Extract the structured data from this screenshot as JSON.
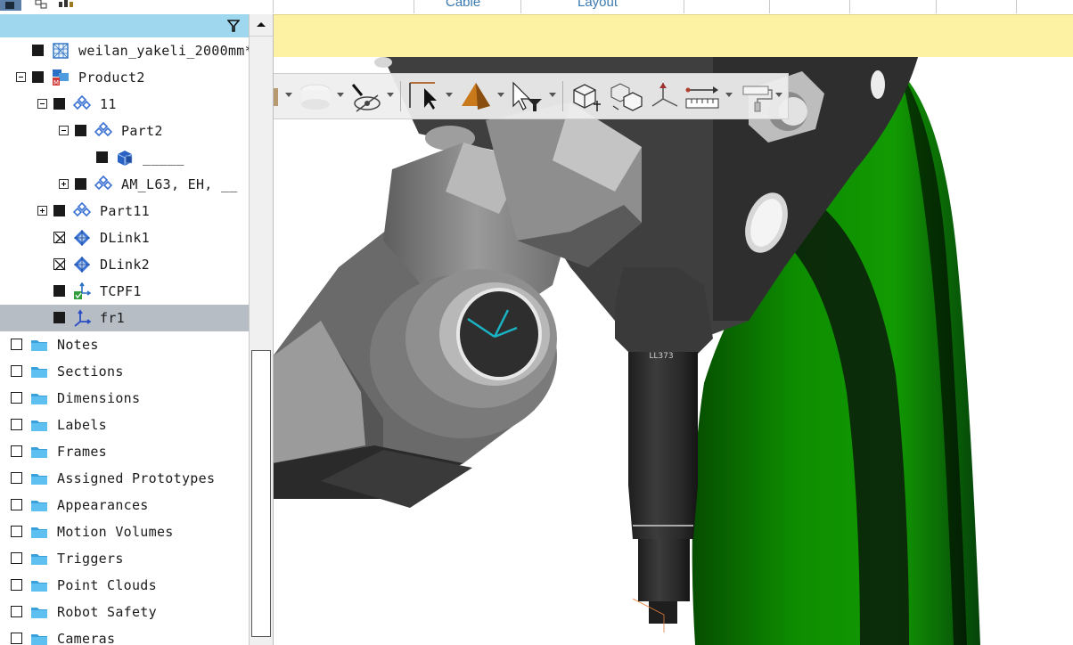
{
  "top_ribbon": {
    "tab_cable": "Cable",
    "tab_layout": "Layout"
  },
  "tree": {
    "filter_icon": "filter-icon",
    "items": [
      {
        "label": "weilan_yakeli_2000mm*",
        "icon": "mesh-part-icon",
        "level": 1,
        "state": "filled",
        "expander": "none"
      },
      {
        "label": "Product2",
        "icon": "product-icon",
        "level": 1,
        "state": "filled",
        "expander": "minus"
      },
      {
        "label": "11",
        "icon": "component-icon",
        "level": 2,
        "state": "filled",
        "expander": "minus"
      },
      {
        "label": "Part2",
        "icon": "component-icon",
        "level": 3,
        "state": "filled",
        "expander": "minus"
      },
      {
        "label": "_____",
        "icon": "part-body-icon",
        "level": 4,
        "state": "filled",
        "expander": "none"
      },
      {
        "label": "AM_L63, EH, __",
        "icon": "component-icon",
        "level": 3,
        "state": "filled",
        "expander": "plus"
      },
      {
        "label": "Part11",
        "icon": "component-icon",
        "level": 2,
        "state": "filled",
        "expander": "plus"
      },
      {
        "label": "DLink1",
        "icon": "link-icon",
        "level": 2,
        "state": "crossed",
        "expander": "none"
      },
      {
        "label": "DLink2",
        "icon": "link-icon",
        "level": 2,
        "state": "crossed",
        "expander": "none"
      },
      {
        "label": "TCPF1",
        "icon": "tcp-frame-icon",
        "level": 2,
        "state": "filled",
        "expander": "none"
      },
      {
        "label": "fr1",
        "icon": "frame-icon",
        "level": 2,
        "state": "filled",
        "expander": "none",
        "selected": true
      },
      {
        "label": "Notes",
        "icon": "folder-icon",
        "level": 0,
        "state": "empty",
        "expander": "none"
      },
      {
        "label": "Sections",
        "icon": "folder-icon",
        "level": 0,
        "state": "empty",
        "expander": "none"
      },
      {
        "label": "Dimensions",
        "icon": "folder-icon",
        "level": 0,
        "state": "empty",
        "expander": "none"
      },
      {
        "label": "Labels",
        "icon": "folder-icon",
        "level": 0,
        "state": "empty",
        "expander": "none"
      },
      {
        "label": "Frames",
        "icon": "folder-icon",
        "level": 0,
        "state": "empty",
        "expander": "none"
      },
      {
        "label": "Assigned Prototypes",
        "icon": "folder-icon",
        "level": 0,
        "state": "empty",
        "expander": "none"
      },
      {
        "label": "Appearances",
        "icon": "folder-icon",
        "level": 0,
        "state": "empty",
        "expander": "none"
      },
      {
        "label": "Motion Volumes",
        "icon": "folder-icon",
        "level": 0,
        "state": "empty",
        "expander": "none"
      },
      {
        "label": "Triggers",
        "icon": "folder-icon",
        "level": 0,
        "state": "empty",
        "expander": "none"
      },
      {
        "label": "Point Clouds",
        "icon": "folder-icon",
        "level": 0,
        "state": "empty",
        "expander": "none"
      },
      {
        "label": "Robot Safety",
        "icon": "folder-icon",
        "level": 0,
        "state": "empty",
        "expander": "none"
      },
      {
        "label": "Cameras",
        "icon": "folder-icon",
        "level": 0,
        "state": "empty",
        "expander": "none"
      }
    ]
  },
  "toolbar": {
    "buttons": [
      {
        "name": "shaded-display-button",
        "icon": "cylinder-shaded-icon"
      },
      {
        "name": "hide-show-button",
        "icon": "eye-hidden-icon"
      },
      {
        "name": "select-frame-button",
        "icon": "select-frame-icon"
      },
      {
        "name": "pyramid-shape-button",
        "icon": "pyramid-icon"
      },
      {
        "name": "pick-filter-button",
        "icon": "pick-filter-icon"
      },
      {
        "name": "placement-manipulator-button",
        "icon": "placement-cube-icon"
      },
      {
        "name": "relocate-button",
        "icon": "relocate-cubes-icon"
      },
      {
        "name": "frame-axes-button",
        "icon": "axes-icon"
      },
      {
        "name": "measure-button",
        "icon": "ruler-icon"
      },
      {
        "name": "paint-button",
        "icon": "paint-roller-icon"
      }
    ]
  },
  "colors": {
    "tree_header": "#9fd7ef",
    "info_bar": "#fdf1a4",
    "selected_row": "#b6bdc4",
    "folder": "#3aa0dc",
    "component": "#3a72d4",
    "green_part": "#0c8a00",
    "metal_dark": "#3c3c3c",
    "frame_axes": "#1ab3c4"
  }
}
